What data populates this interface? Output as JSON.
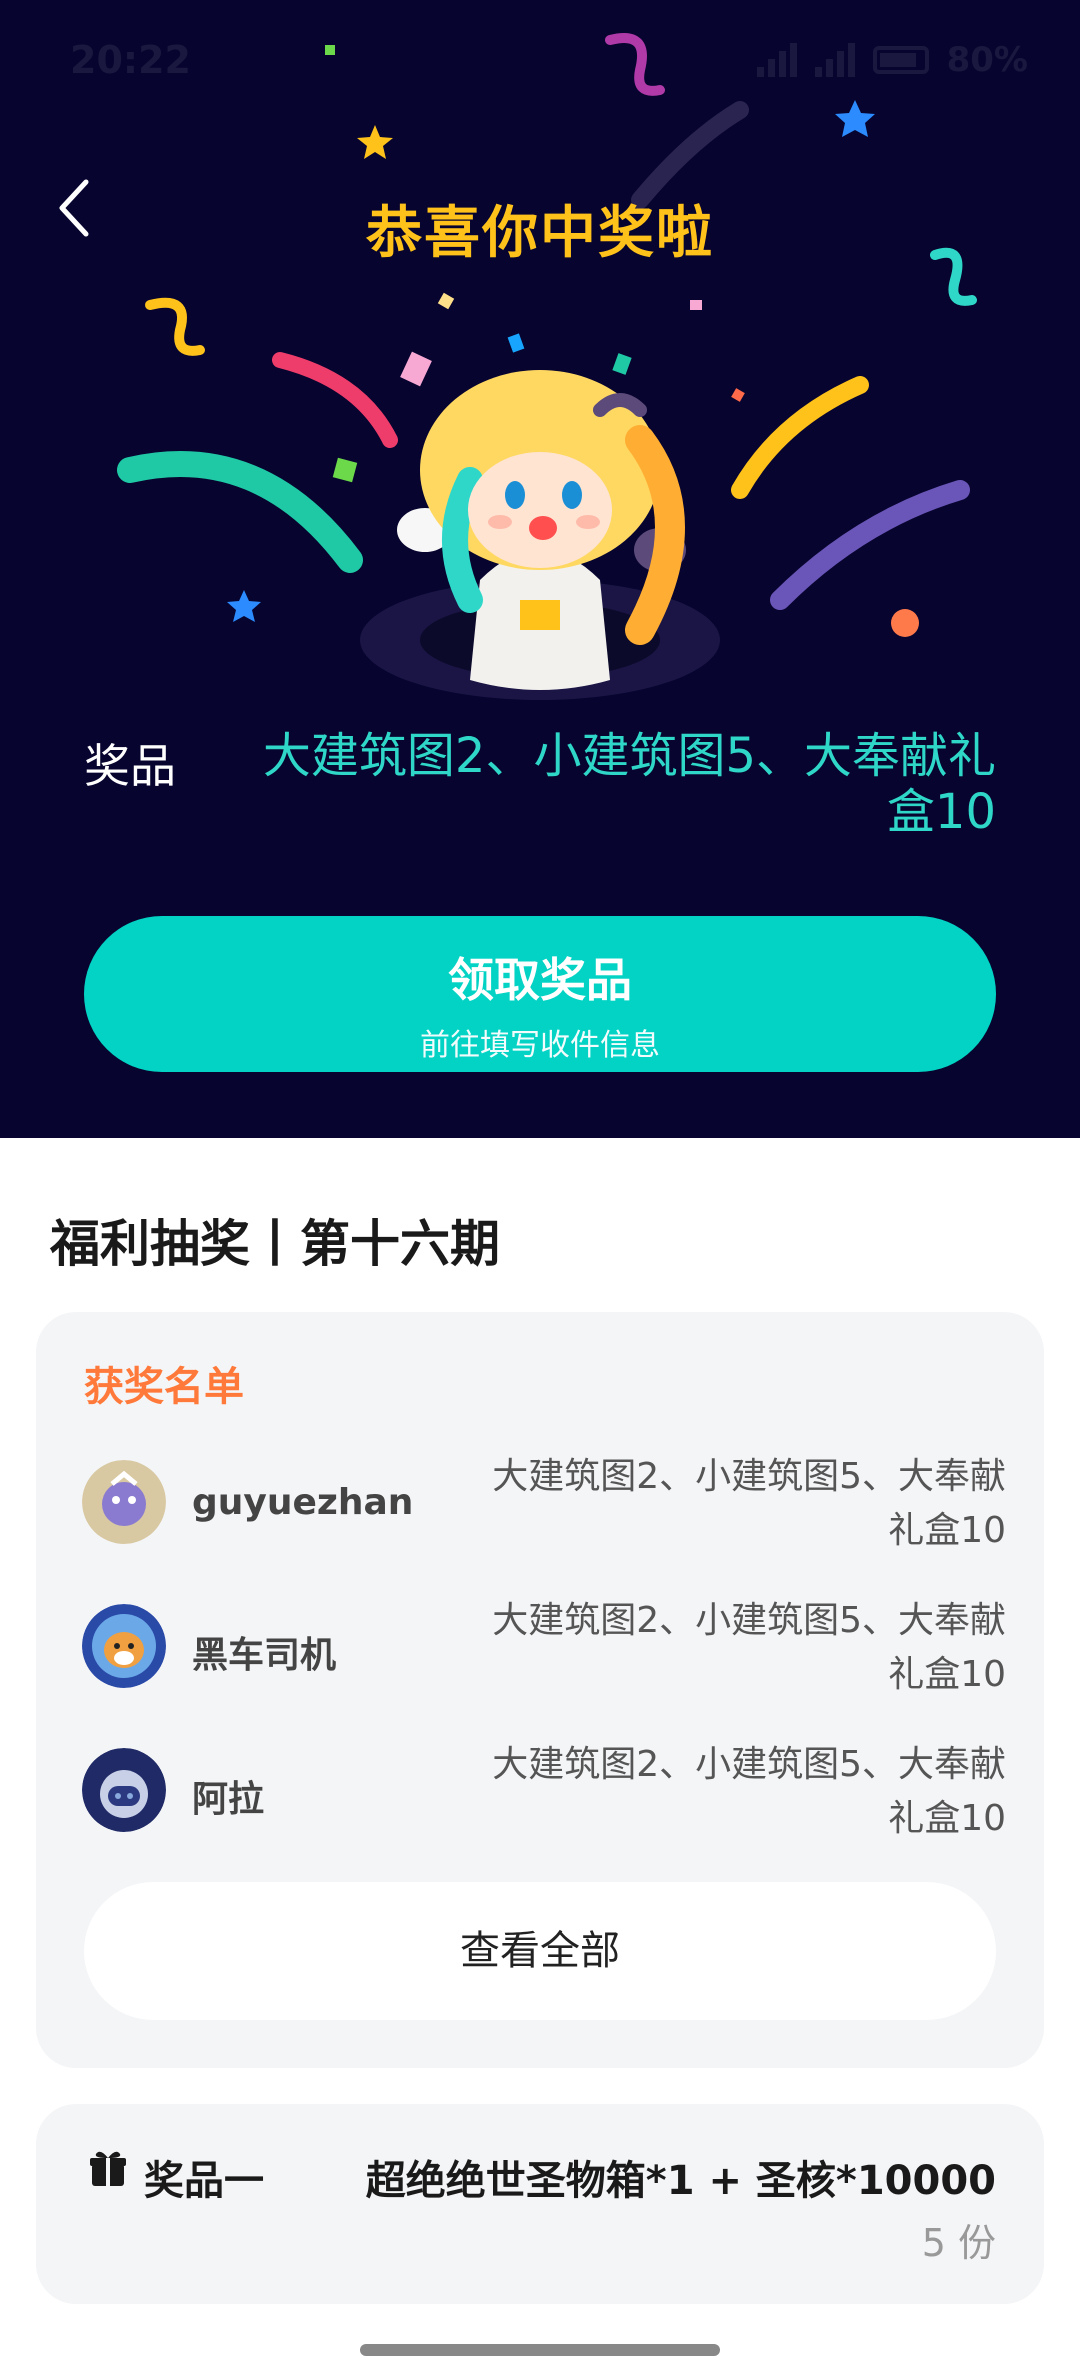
{
  "status_bar": {
    "time": "20:22",
    "battery": "80%"
  },
  "header": {
    "title": "恭喜你中奖啦"
  },
  "prize": {
    "label": "奖品",
    "value": "大建筑图2、小建筑图5、大奉献礼盒10"
  },
  "claim_button": {
    "label": "领取奖品",
    "sublabel": "前往填写收件信息"
  },
  "section": {
    "title": "福利抽奖丨第十六期"
  },
  "winners": {
    "title": "获奖名单",
    "items": [
      {
        "name": "guyuezhan",
        "prize": "大建筑图2、小建筑图5、大奉献礼盒10"
      },
      {
        "name": "黑车司机",
        "prize": "大建筑图2、小建筑图5、大奉献礼盒10"
      },
      {
        "name": "阿拉",
        "prize": "大建筑图2、小建筑图5、大奉献礼盒10"
      }
    ],
    "view_all": "查看全部"
  },
  "prize_item": {
    "label": "奖品一",
    "value": "超绝绝世圣物箱*1 + 圣核*10000",
    "count": "5 份"
  },
  "colors": {
    "hero_bg": "#07042f",
    "accent": "#02d3c4",
    "title_gold": "#ffc21a",
    "winners_title": "#ff7a3a"
  }
}
